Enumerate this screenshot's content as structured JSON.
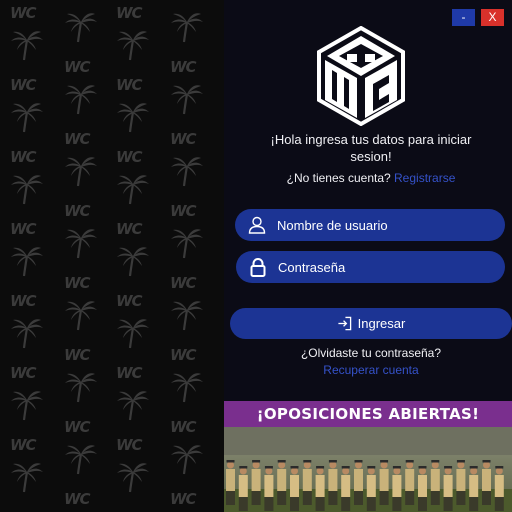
{
  "window": {
    "minimize_label": "-",
    "close_label": "X"
  },
  "background": {
    "pattern_text": "WC"
  },
  "logo": {
    "letters": "WC"
  },
  "login": {
    "greeting": "¡Hola ingresa tus datos para iniciar sesion!",
    "no_account": "¿No tienes cuenta?",
    "register_link": "Registrarse",
    "username_placeholder": "Nombre de usuario",
    "password_placeholder": "Contraseña",
    "submit_label": "Ingresar",
    "forgot_text": "¿Olvidaste tu contraseña?",
    "recover_link": "Recuperar cuenta"
  },
  "banner": {
    "title": "¡OPOSICIONES ABIERTAS!"
  },
  "colors": {
    "accent": "#1c3494",
    "link": "#3552c9",
    "close": "#d9312b",
    "banner": "#7a2f8e"
  }
}
